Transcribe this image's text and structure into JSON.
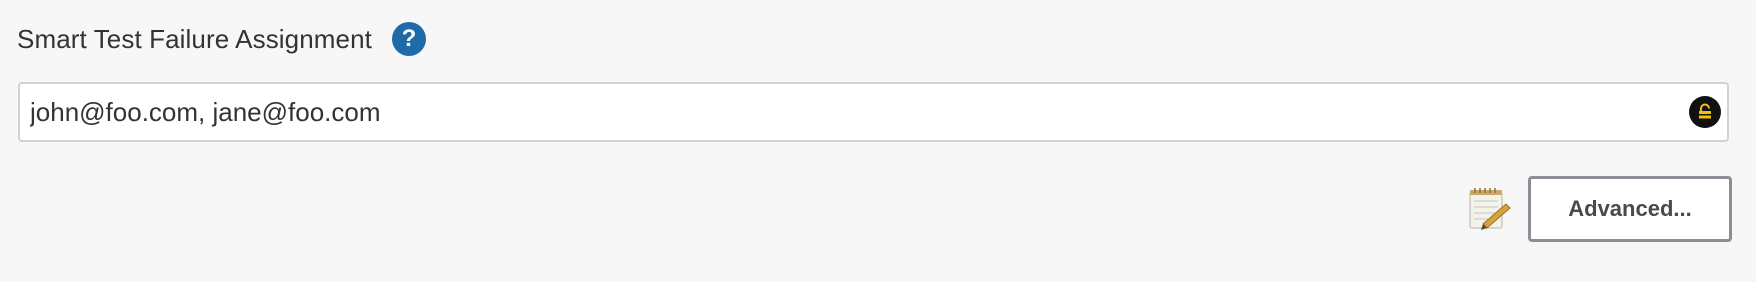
{
  "section": {
    "title": "Smart Test Failure Assignment",
    "help_icon": "question-mark-icon",
    "help_color": "#1f6aa8"
  },
  "assignees_field": {
    "value": "john@foo.com, jane@foo.com",
    "trailing_icon": "lock-icon",
    "trailing_icon_color": "#f2c200"
  },
  "actions": {
    "notepad_icon": "notepad-edit-icon",
    "advanced_label": "Advanced..."
  }
}
